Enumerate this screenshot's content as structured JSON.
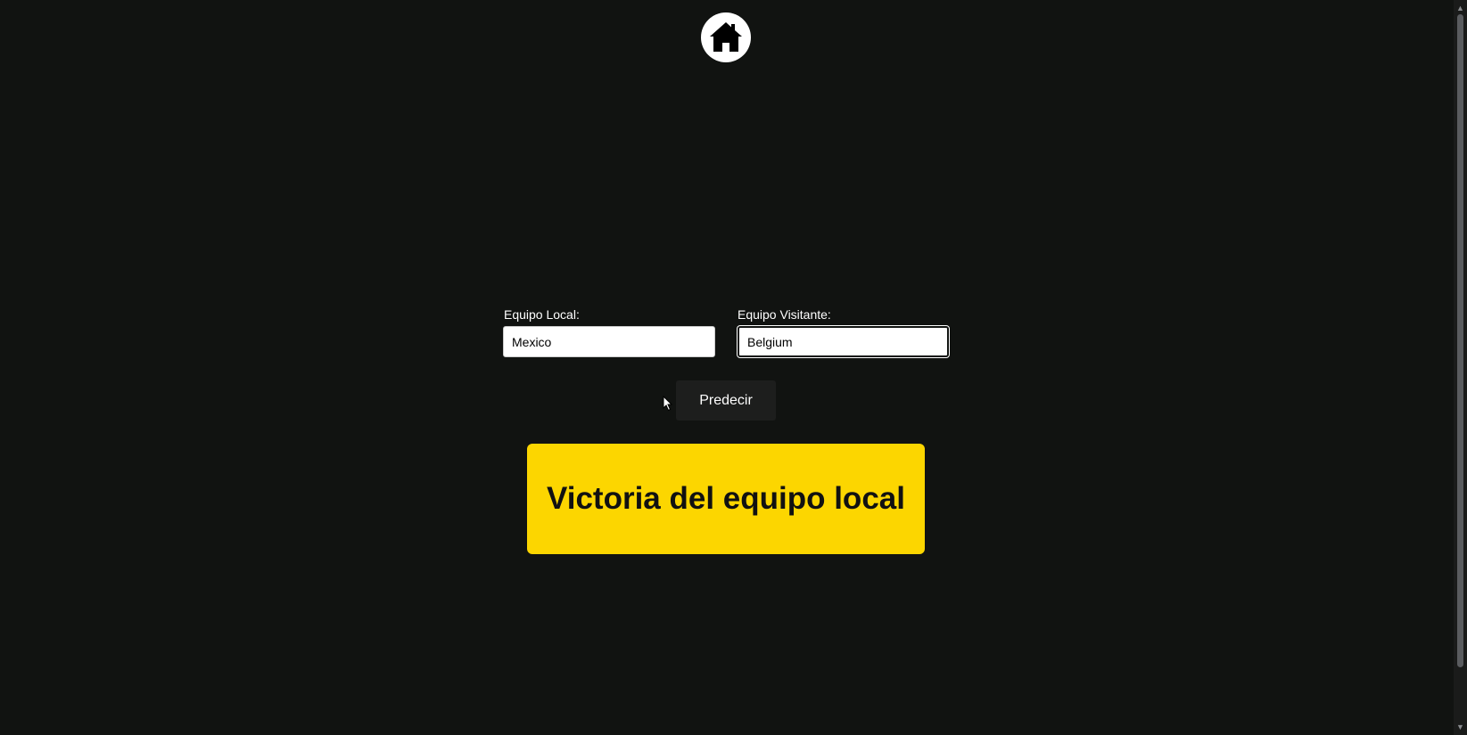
{
  "header": {
    "home_icon": "home-icon"
  },
  "form": {
    "local_label": "Equipo Local:",
    "local_value": "Mexico",
    "visitor_label": "Equipo Visitante:",
    "visitor_value": "Belgium",
    "predict_label": "Predecir"
  },
  "result": {
    "text": "Victoria del equipo local"
  },
  "colors": {
    "background": "#111311",
    "result_bg": "#fcd600",
    "button_bg": "#1d1e1d"
  }
}
